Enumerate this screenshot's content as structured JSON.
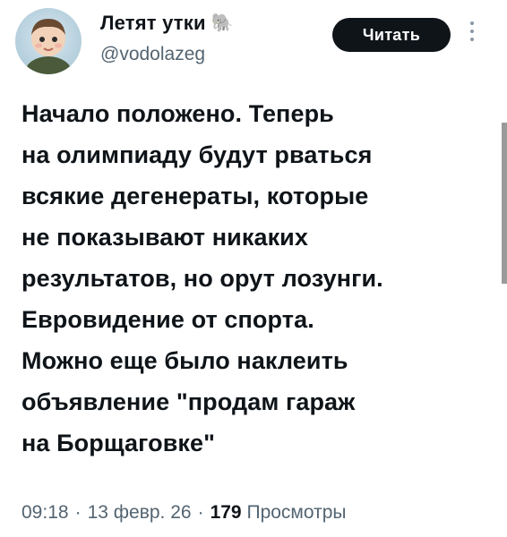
{
  "author": {
    "display_name": "Летят утки",
    "name_emoji": "🐘",
    "handle": "@vodolazeg"
  },
  "actions": {
    "read_label": "Читать"
  },
  "tweet": {
    "lines": [
      "Начало положено. Теперь",
      "на олимпиаду будут рваться",
      "всякие дегенераты, которые",
      "не показывают никаких",
      "результатов, но орут лозунги.",
      "Евровидение от спорта.",
      "Можно еще было наклеить",
      "объявление \"продам гараж",
      "на Борщаговке\""
    ]
  },
  "meta": {
    "time": "09:18",
    "separator": "·",
    "date": "13 февр. 26",
    "views_count": "179",
    "views_label": "Просмотры"
  }
}
